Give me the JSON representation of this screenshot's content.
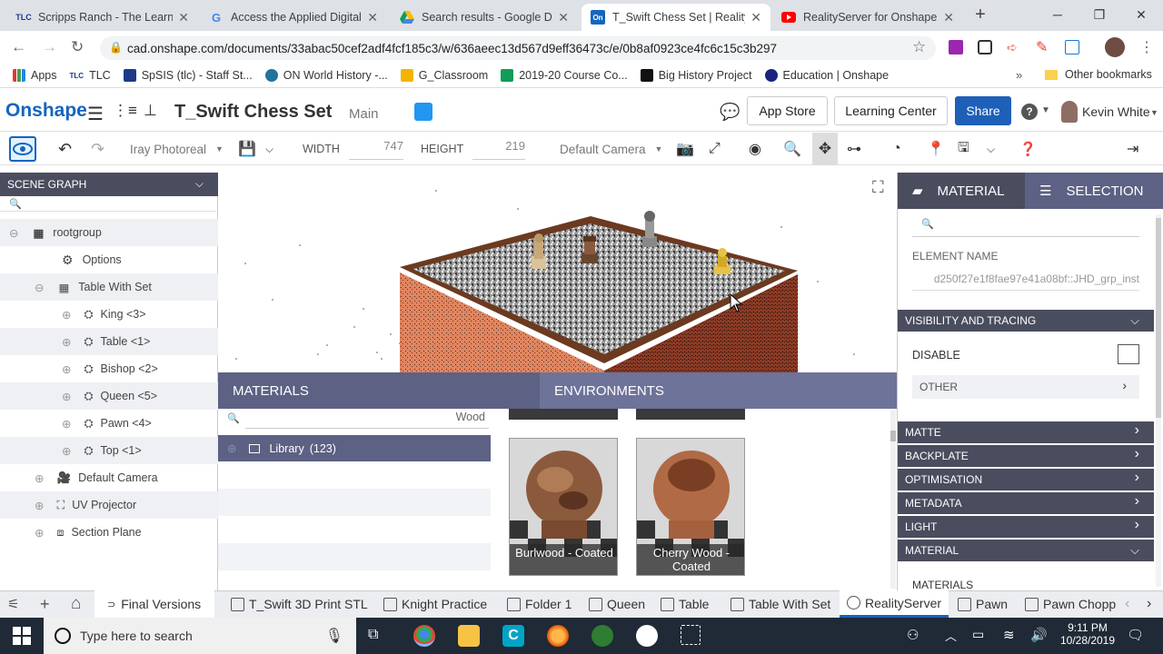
{
  "browser": {
    "tabs": [
      {
        "title": "Scripps Ranch - The Learnin",
        "icon": "tlc-icon"
      },
      {
        "title": "Access the Applied Digital S",
        "icon": "google-icon"
      },
      {
        "title": "Search results - Google Driv",
        "icon": "google-drive-icon"
      },
      {
        "title": "T_Swift Chess Set | RealitySe",
        "icon": "onshape-icon"
      },
      {
        "title": "RealityServer for Onshape -",
        "icon": "youtube-icon"
      }
    ],
    "url": "cad.onshape.com/documents/33abac50cef2adf4fcf185c3/w/636aeec13d567d9eff36473c/e/0b8af0923ce4fc6c15c3b297",
    "bookmarks": [
      "Apps",
      "TLC",
      "SpSIS (tlc) - Staff St...",
      "ON World History -...",
      "G_Classroom",
      "2019-20 Course Co...",
      "Big History Project",
      "Education | Onshape"
    ],
    "other_bookmarks": "Other bookmarks"
  },
  "header": {
    "logo": "Onshape",
    "doc_title": "T_Swift Chess Set",
    "branch": "Main",
    "app_store": "App Store",
    "learning_center": "Learning Center",
    "share": "Share",
    "user": "Kevin White"
  },
  "toolbar": {
    "renderer": "Iray Photoreal",
    "width_label": "WIDTH",
    "width_value": "747",
    "height_label": "HEIGHT",
    "height_value": "219",
    "camera": "Default Camera"
  },
  "scene_graph": {
    "title": "SCENE GRAPH",
    "items": [
      "rootgroup",
      "Options",
      "Table With Set",
      "King <3>",
      "Table <1>",
      "Bishop <2>",
      "Queen <5>",
      "Pawn <4>",
      "Top <1>",
      "Default Camera",
      "UV Projector",
      "Section Plane"
    ]
  },
  "materials_panel": {
    "tab_materials": "MATERIALS",
    "tab_environments": "ENVIRONMENTS",
    "search_value": "Wood",
    "library_label": "Library",
    "library_count": "(123)",
    "swatches": [
      "Burlwood - Coated",
      "Cherry Wood - Coated"
    ]
  },
  "right_panel": {
    "tab_material": "MATERIAL",
    "tab_selection": "SELECTION",
    "element_name_label": "ELEMENT NAME",
    "element_name_value": "d250f27e1f8fae97e41a08bf::JHD_grp_inst",
    "visibility_section": "VISIBILITY AND TRACING",
    "disable_label": "DISABLE",
    "other_label": "OTHER",
    "sections": [
      "MATTE",
      "BACKPLATE",
      "OPTIMISATION",
      "METADATA",
      "LIGHT",
      "MATERIAL"
    ],
    "materials_label": "MATERIALS"
  },
  "doc_tabs": [
    "Final Versions",
    "T_Swift 3D Print STL",
    "Knight Practice",
    "Folder 1",
    "Queen",
    "Table",
    "Table With Set",
    "RealityServer",
    "Pawn",
    "Pawn Chopp"
  ],
  "taskbar": {
    "search_placeholder": "Type here to search",
    "time": "9:11 PM",
    "date": "10/28/2019"
  },
  "colors": {
    "onshape_blue": "#1565c0",
    "panel_header": "#4a4d5e",
    "materials_header": "#5d6183",
    "share_button": "#1e5fb8"
  }
}
